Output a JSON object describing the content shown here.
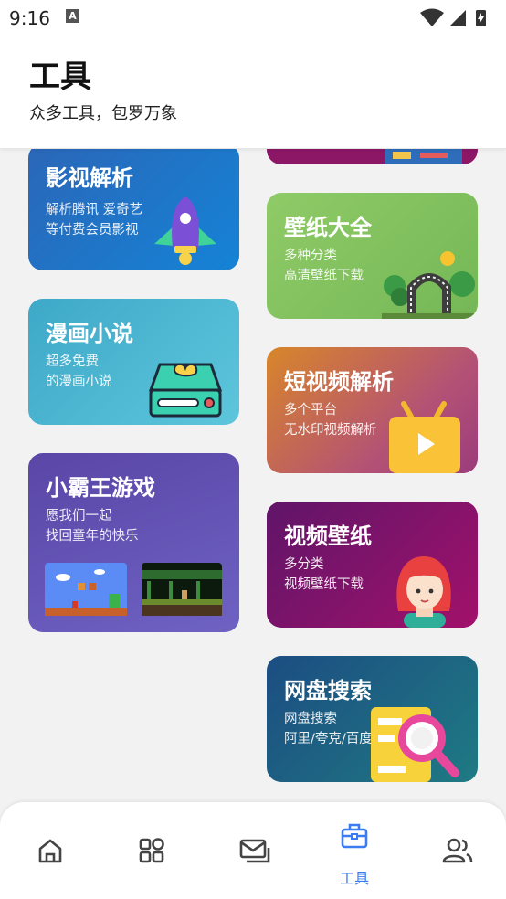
{
  "status_bar": {
    "time": "9:16",
    "notification_icon": "a-icon"
  },
  "header": {
    "title": "工具",
    "subtitle": "众多工具，包罗万象"
  },
  "cards": {
    "yingshi": {
      "title": "影视解析",
      "desc1": "解析腾讯 爱奇艺",
      "desc2": "等付费会员影视",
      "icon": "rocket-icon"
    },
    "bizhi": {
      "title": "壁纸大全",
      "desc1": "多种分类",
      "desc2": "高清壁纸下载",
      "icon": "gate-icon"
    },
    "manhua": {
      "title": "漫画小说",
      "desc1": "超多免费",
      "desc2": "的漫画小说",
      "icon": "drive-icon"
    },
    "duanshi": {
      "title": "短视频解析",
      "desc1": "多个平台",
      "desc2": "无水印视频解析",
      "icon": "tv-play-icon"
    },
    "xiaobawang": {
      "title": "小霸王游戏",
      "desc1": "愿我们一起",
      "desc2": "找回童年的快乐",
      "icon": "game-screens"
    },
    "shipin": {
      "title": "视频壁纸",
      "desc1": "多分类",
      "desc2": "视频壁纸下载",
      "icon": "girl-avatar-icon"
    },
    "wangpan": {
      "title": "网盘搜索",
      "desc1": "网盘搜索",
      "desc2": "阿里/夸克/百度",
      "icon": "search-doc-icon"
    }
  },
  "nav": {
    "active": "tools",
    "items": [
      {
        "id": "home",
        "icon": "home-icon",
        "label": ""
      },
      {
        "id": "apps",
        "icon": "grid-icon",
        "label": ""
      },
      {
        "id": "messages",
        "icon": "mail-icon",
        "label": ""
      },
      {
        "id": "tools",
        "icon": "toolbox-icon",
        "label": "工具"
      },
      {
        "id": "users",
        "icon": "users-icon",
        "label": ""
      }
    ]
  },
  "colors": {
    "accent": "#3b7df0",
    "nav_inactive": "#444444"
  }
}
